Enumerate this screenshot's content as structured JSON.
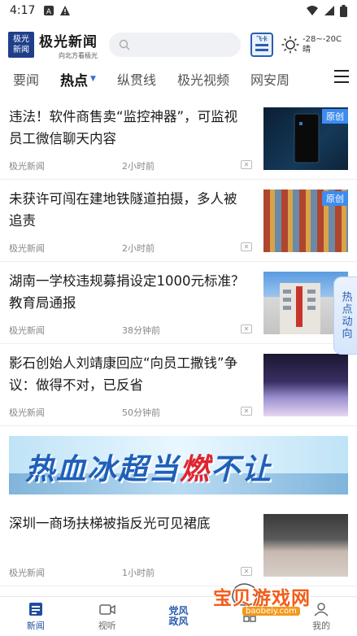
{
  "status_bar": {
    "time": "4:17"
  },
  "header": {
    "logo_line1": "极光",
    "logo_line2": "新闻",
    "logo_title": "极光新闻",
    "logo_slogan": "向北方看极光",
    "card_label": "飞卡",
    "weather_temp": "-28~-20C",
    "weather_desc": "晴"
  },
  "tabs": [
    "要闻",
    "热点",
    "纵贯线",
    "极光视频",
    "网安周"
  ],
  "feed": [
    {
      "title": "违法！软件商售卖“监控神器”，可监视员工微信聊天内容",
      "source": "极光新闻",
      "time": "2小时前",
      "badge": "原创"
    },
    {
      "title": "未获许可闯在建地铁隧道拍摄，多人被追责",
      "source": "极光新闻",
      "time": "2小时前",
      "badge": "原创"
    },
    {
      "title": "湖南一学校违规募捐设定1000元标准？教育局通报",
      "source": "极光新闻",
      "time": "38分钟前",
      "badge": ""
    },
    {
      "title": "影石创始人刘靖康回应“向员工撒钱”争议：做得不对，已反省",
      "source": "极光新闻",
      "time": "50分钟前",
      "badge": ""
    }
  ],
  "banner": {
    "text_a": "热血冰超当",
    "text_b": "燃",
    "text_c": "不让"
  },
  "feed2": [
    {
      "title": "深圳一商场扶梯被指反光可见裙底",
      "source": "极光新闻",
      "time": "1小时前"
    }
  ],
  "side_tab": "热点动向",
  "bottom_nav": {
    "news": "新闻",
    "video": "视听",
    "center_line1": "党风",
    "center_line2": "政风",
    "mine": "我的"
  },
  "watermark": {
    "text": "宝贝游戏网",
    "url": "baobeiy.com"
  }
}
